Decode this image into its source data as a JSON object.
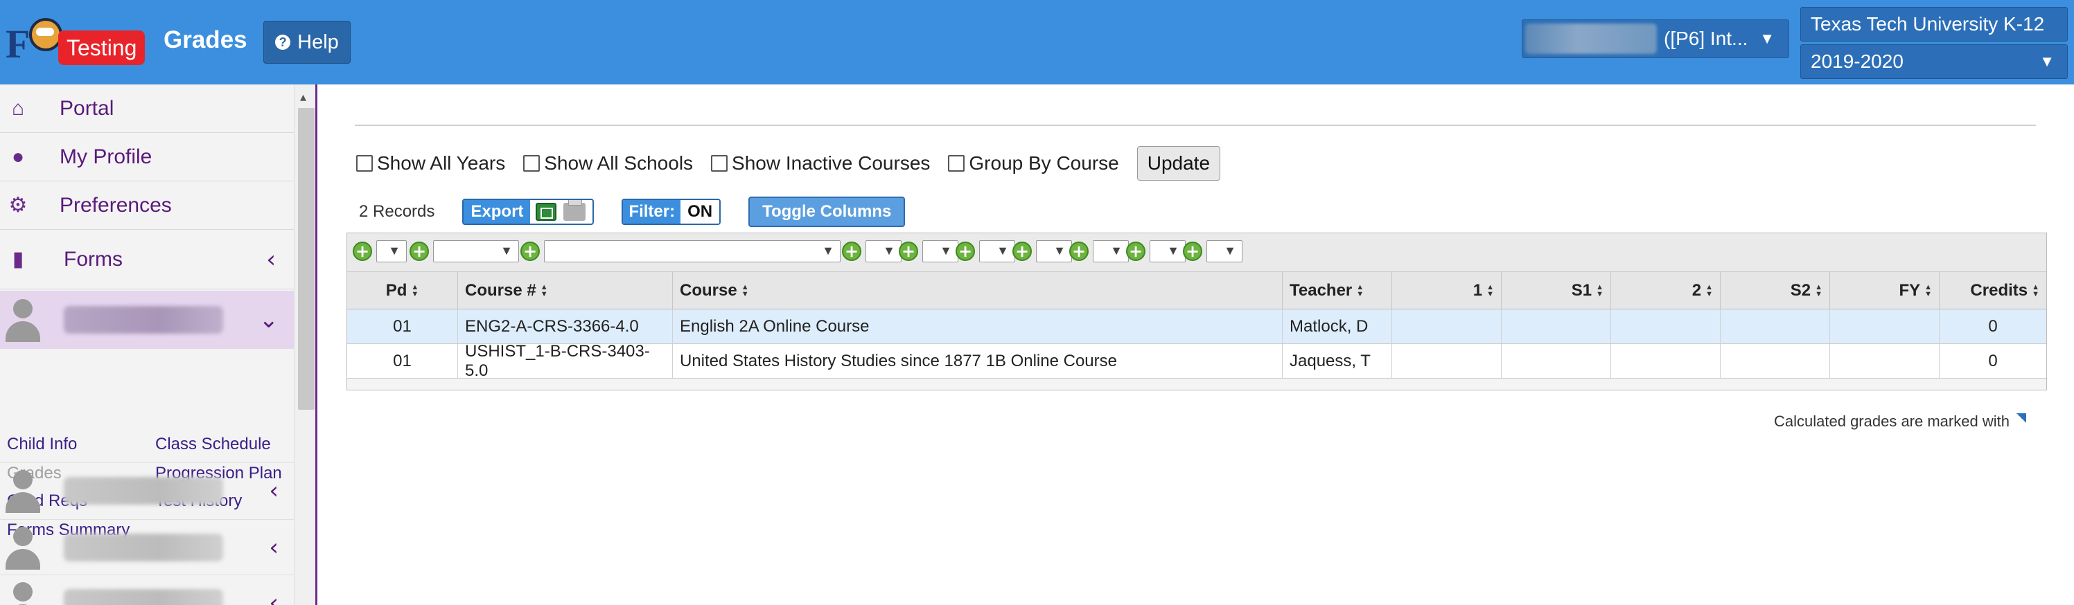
{
  "header": {
    "logo_badge": "Testing",
    "page_title": "Grades",
    "help_label": "Help",
    "user_selector": "([P6] Int...",
    "school": "Texas Tech University K-12",
    "year": "2019-2020"
  },
  "sidebar": {
    "nav": [
      {
        "label": "Portal"
      },
      {
        "label": "My Profile"
      },
      {
        "label": "Preferences"
      },
      {
        "label": "Forms"
      }
    ],
    "sublinks": {
      "child_info": "Child Info",
      "class_schedule": "Class Schedule",
      "grades": "Grades",
      "progression_plan": "Progression Plan",
      "grad_reqs": "Grad Reqs",
      "test_history": "Test History",
      "forms_summary": "Forms Summary"
    }
  },
  "filters": {
    "show_all_years": "Show All Years",
    "show_all_schools": "Show All Schools",
    "show_inactive_courses": "Show Inactive Courses",
    "group_by_course": "Group By Course",
    "update": "Update"
  },
  "toolbar": {
    "records": "2 Records",
    "export": "Export",
    "filter_label": "Filter:",
    "filter_state": "ON",
    "toggle_columns": "Toggle Columns"
  },
  "grid": {
    "columns": [
      "Pd",
      "Course #",
      "Course",
      "Teacher",
      "1",
      "S1",
      "2",
      "S2",
      "FY",
      "Credits"
    ],
    "rows": [
      {
        "pd": "01",
        "course_num": "ENG2-A-CRS-3366-4.0",
        "course": "English 2A Online Course",
        "teacher": "Matlock, D",
        "g1": "",
        "s1": "",
        "g2": "",
        "s2": "",
        "fy": "",
        "credits": "0"
      },
      {
        "pd": "01",
        "course_num": "USHIST_1-B-CRS-3403-5.0",
        "course": "United States History Studies since 1877 1B Online Course",
        "teacher": "Jaquess, T",
        "g1": "",
        "s1": "",
        "g2": "",
        "s2": "",
        "fy": "",
        "credits": "0"
      }
    ]
  },
  "footnote": "Calculated grades are marked with",
  "colors": {
    "header_bg": "#3b8fde",
    "sidebar_accent": "#6c2d8c",
    "selected_row": "#deedfb",
    "plus_green": "#6db33f"
  }
}
